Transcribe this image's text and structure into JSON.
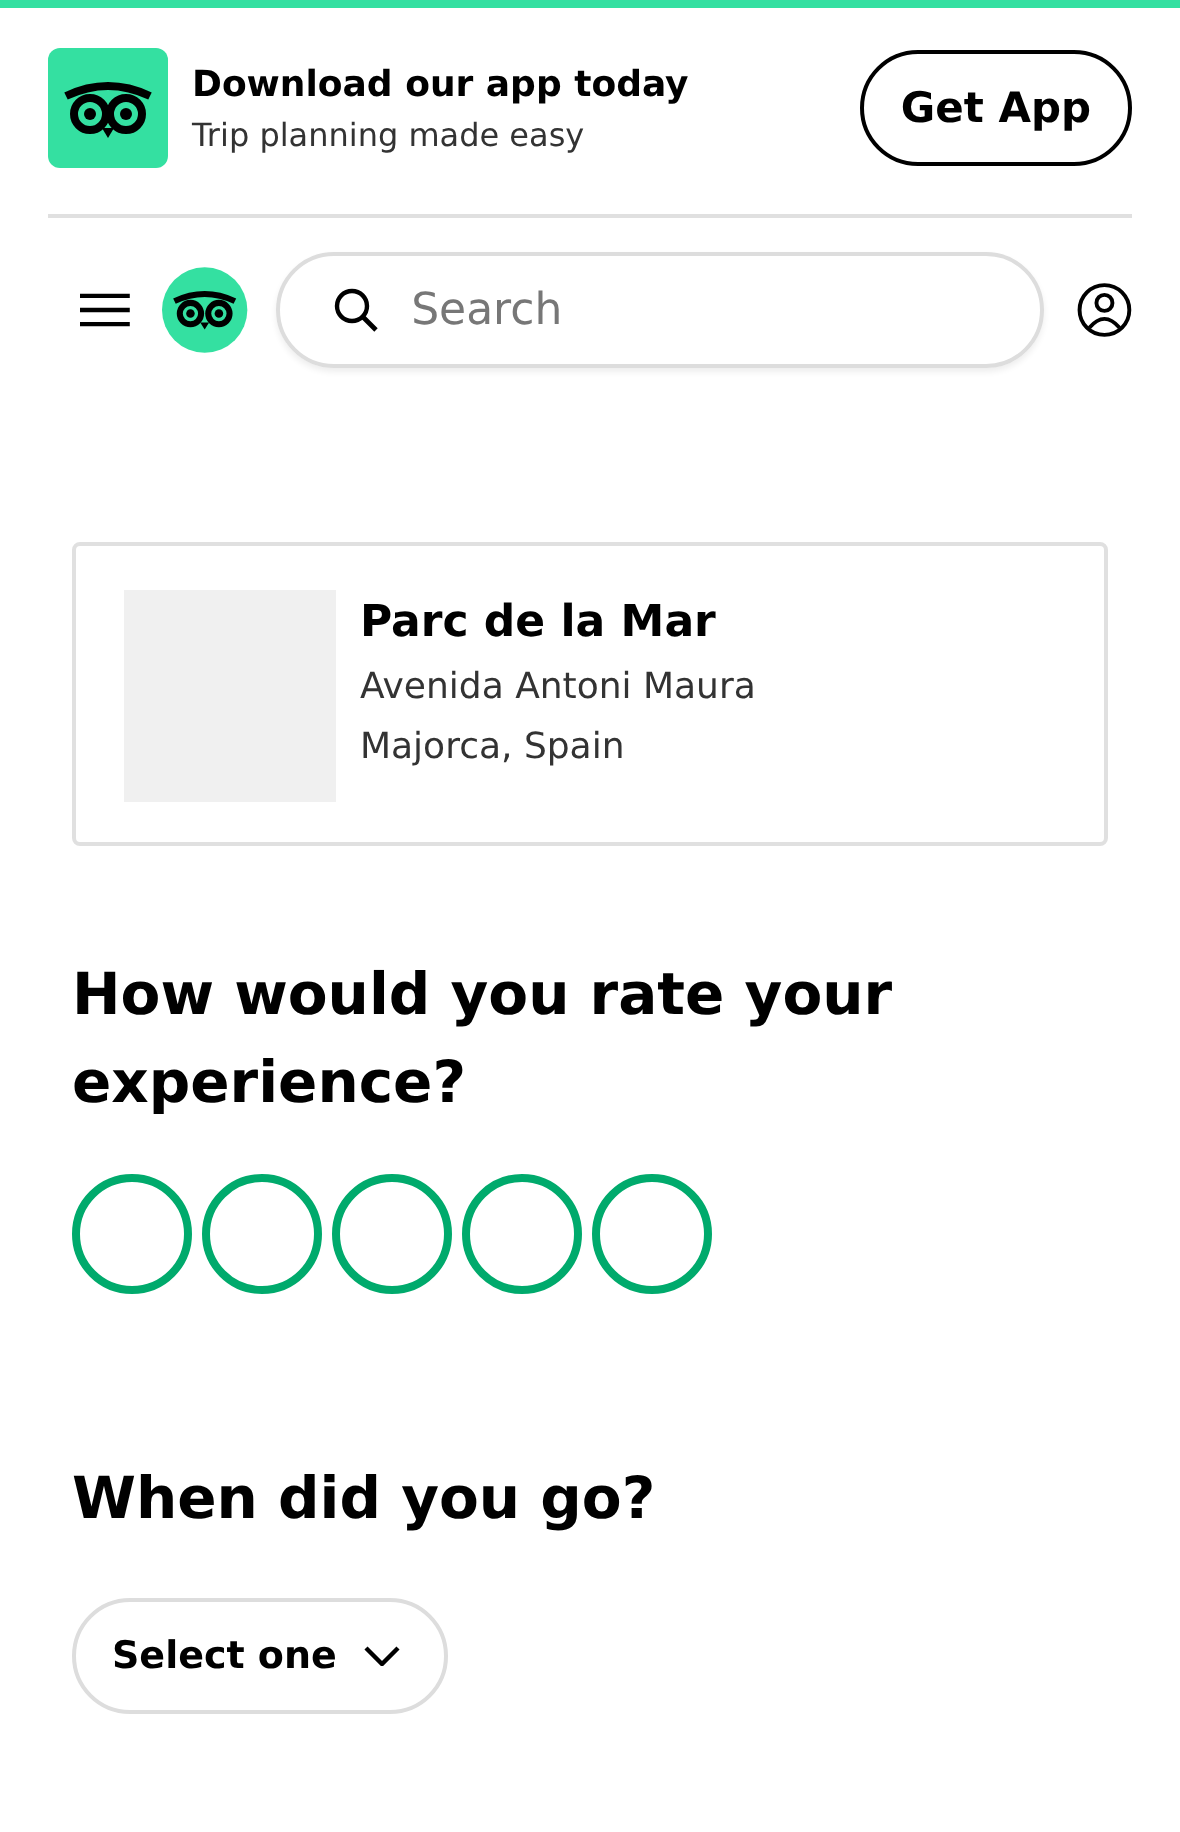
{
  "banner": {
    "title": "Download our app today",
    "subtitle": "Trip planning made easy",
    "button": "Get App"
  },
  "header": {
    "search": {
      "placeholder": "Search"
    }
  },
  "place": {
    "name": "Parc de la Mar",
    "address_line_1": "Avenida Antoni Maura",
    "address_line_2": "Majorca, Spain"
  },
  "rating": {
    "question": "How would you rate your experience?",
    "stars": 0
  },
  "visit": {
    "question": "When did you go?",
    "select": "Select one"
  }
}
